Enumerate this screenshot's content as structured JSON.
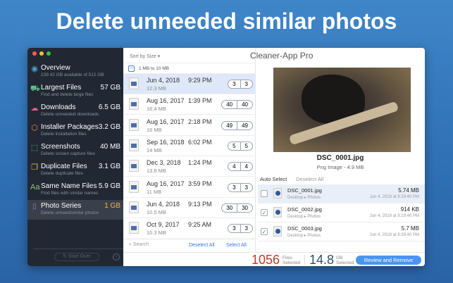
{
  "headline": "Delete unneeded similar photos",
  "app_title": "Cleaner-App Pro",
  "sidebar": {
    "items": [
      {
        "icon": "eye-icon",
        "glyph": "◉",
        "color": "#4aa3d8",
        "title": "Overview",
        "size": "",
        "sub": "239.42 GB available of 512 GB"
      },
      {
        "icon": "truck-icon",
        "glyph": "⛟",
        "color": "#5fbf8f",
        "title": "Largest Files",
        "size": "57 GB",
        "sub": "Find and delete large files"
      },
      {
        "icon": "cloud-download-icon",
        "glyph": "☁",
        "color": "#d8609a",
        "title": "Downloads",
        "size": "6.5 GB",
        "sub": "Delete unneeded downloads"
      },
      {
        "icon": "package-icon",
        "glyph": "⬡",
        "color": "#e0904a",
        "title": "Installer Packages",
        "size": "3.2 GB",
        "sub": "Delete installation files"
      },
      {
        "icon": "screenshot-icon",
        "glyph": "⬚",
        "color": "#4ac0c0",
        "title": "Screenshots",
        "size": "40 MB",
        "sub": "Delete screen capture files"
      },
      {
        "icon": "duplicate-icon",
        "glyph": "❐",
        "color": "#e0b84a",
        "title": "Duplicate Files",
        "size": "3.1 GB",
        "sub": "Delete duplicate files"
      },
      {
        "icon": "text-aa-icon",
        "glyph": "Aa",
        "color": "#8fc07a",
        "title": "Same Name Files",
        "size": "5.9 GB",
        "sub": "Find files with similar names"
      },
      {
        "icon": "camera-icon",
        "glyph": "⌷",
        "color": "#9a8ad8",
        "title": "Photo Series",
        "size": "1 GB",
        "sub": "Delete unneedsimilar photos",
        "active": true
      }
    ],
    "start_over": "Start Over"
  },
  "list": {
    "sort": "Sort by Size ▾",
    "group": "1 MB to 10 MB",
    "rows": [
      {
        "date": "Jun 4, 2018",
        "time": "9:29 PM",
        "size": "12.3 MB",
        "a": "3",
        "b": "3",
        "selected": true
      },
      {
        "date": "Aug 16, 2017",
        "time": "1:39 PM",
        "size": "16.4 MB",
        "a": "40",
        "b": "40"
      },
      {
        "date": "Aug 16, 2017",
        "time": "2:18 PM",
        "size": "16 MB",
        "a": "49",
        "b": "49"
      },
      {
        "date": "Sep 16, 2018",
        "time": "6:02 PM",
        "size": "14 MB",
        "a": "5",
        "b": "5"
      },
      {
        "date": "Dec 3, 2018",
        "time": "1:24 PM",
        "size": "13.8 MB",
        "a": "4",
        "b": "4"
      },
      {
        "date": "Aug 16, 2017",
        "time": "3:59 PM",
        "size": "11 MB",
        "a": "3",
        "b": "3"
      },
      {
        "date": "Jun 4, 2018",
        "time": "9:13 PM",
        "size": "10.5 MB",
        "a": "30",
        "b": "30"
      },
      {
        "date": "Oct 9, 2017",
        "time": "9:25 AM",
        "size": "10.3 MB",
        "a": "3",
        "b": "3"
      }
    ],
    "search": "Search",
    "deselect_all": "Deselect All",
    "select_all": "Select All"
  },
  "preview": {
    "name": "DSC_0001.jpg",
    "info": "Png Image - 4.9 MB",
    "auto_select": "Auto Select",
    "deselect_all": "Deselect All",
    "files": [
      {
        "name": "DSC_0001.jpg",
        "path": "Desktop ▸ Photos",
        "size": "5.74 MB",
        "date": "Jun 4, 2018 at 9:29:40 PM",
        "checked": false
      },
      {
        "name": "DSC_0002.jpg",
        "path": "Desktop ▸ Photos",
        "size": "914 KB",
        "date": "Jun 4, 2018 at 9:29:40 PM",
        "checked": true
      },
      {
        "name": "DSC_0003.jpg",
        "path": "Desktop ▸ Photos",
        "size": "5.7 MB",
        "date": "Jun 4, 2018 at 9:29:40 PM",
        "checked": true
      }
    ]
  },
  "footer": {
    "files_count": "1056",
    "files_label1": "Files",
    "files_label2": "Selected",
    "gb_count": "14.8",
    "gb_label1": "GB",
    "gb_label2": "Selected",
    "review": "Review and Remove"
  }
}
